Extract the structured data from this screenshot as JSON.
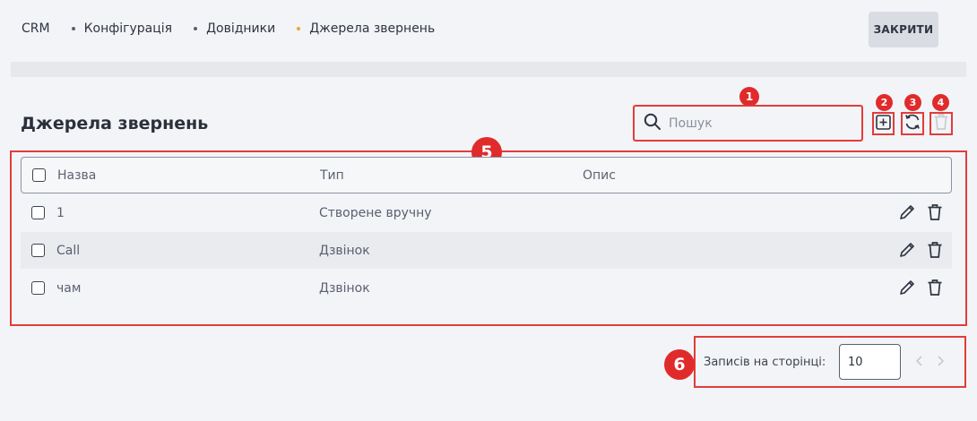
{
  "breadcrumb": {
    "items": [
      "CRM",
      "Конфігурація",
      "Довідники",
      "Джерела звернень"
    ]
  },
  "header": {
    "close_label": "ЗАКРИТИ"
  },
  "page": {
    "title": "Джерела звернень"
  },
  "search": {
    "placeholder": "Пошук"
  },
  "table": {
    "columns": [
      "Назва",
      "Тип",
      "Опис"
    ],
    "rows": [
      {
        "name": "1",
        "type": "Створене вручну",
        "description": ""
      },
      {
        "name": "Call",
        "type": "Дзвінок",
        "description": ""
      },
      {
        "name": "чам",
        "type": "Дзвінок",
        "description": ""
      }
    ]
  },
  "pagination": {
    "rows_per_page_label": "Записів на сторінці:",
    "rows_per_page_value": "10"
  },
  "annotations": {
    "badge_1": "1",
    "badge_2": "2",
    "badge_3": "3",
    "badge_4": "4",
    "badge_5": "5",
    "badge_6": "6"
  },
  "colors": {
    "annotation_red": "#e23c3c",
    "active_crumb_dot": "#f0a536",
    "background": "#f3f4f7"
  },
  "icons": {
    "search": "search-icon",
    "add": "plus-square-icon",
    "refresh": "refresh-icon",
    "delete": "trash-icon",
    "edit": "pencil-icon"
  }
}
